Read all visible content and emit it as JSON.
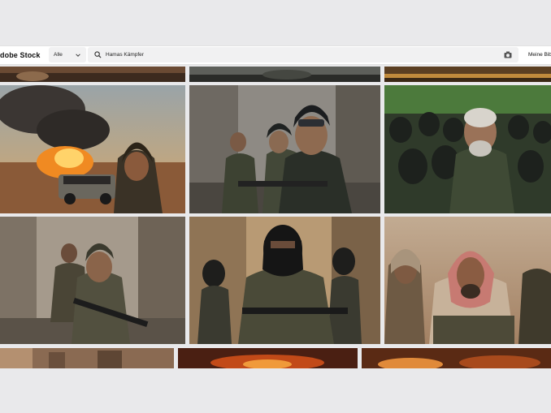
{
  "header": {
    "logo_text": "dobe Stock",
    "filter_label": "Alle",
    "search_value": "Hamas Kämpfer",
    "library_label": "Meine Bibl"
  },
  "icons": {
    "filter_chevron": "chevron-down-icon",
    "search": "search-icon",
    "visual_search": "camera-icon"
  },
  "colors": {
    "page_bg": "#e9e9eb",
    "bar_bg": "#ffffff",
    "field_bg": "#f1f1f2"
  }
}
